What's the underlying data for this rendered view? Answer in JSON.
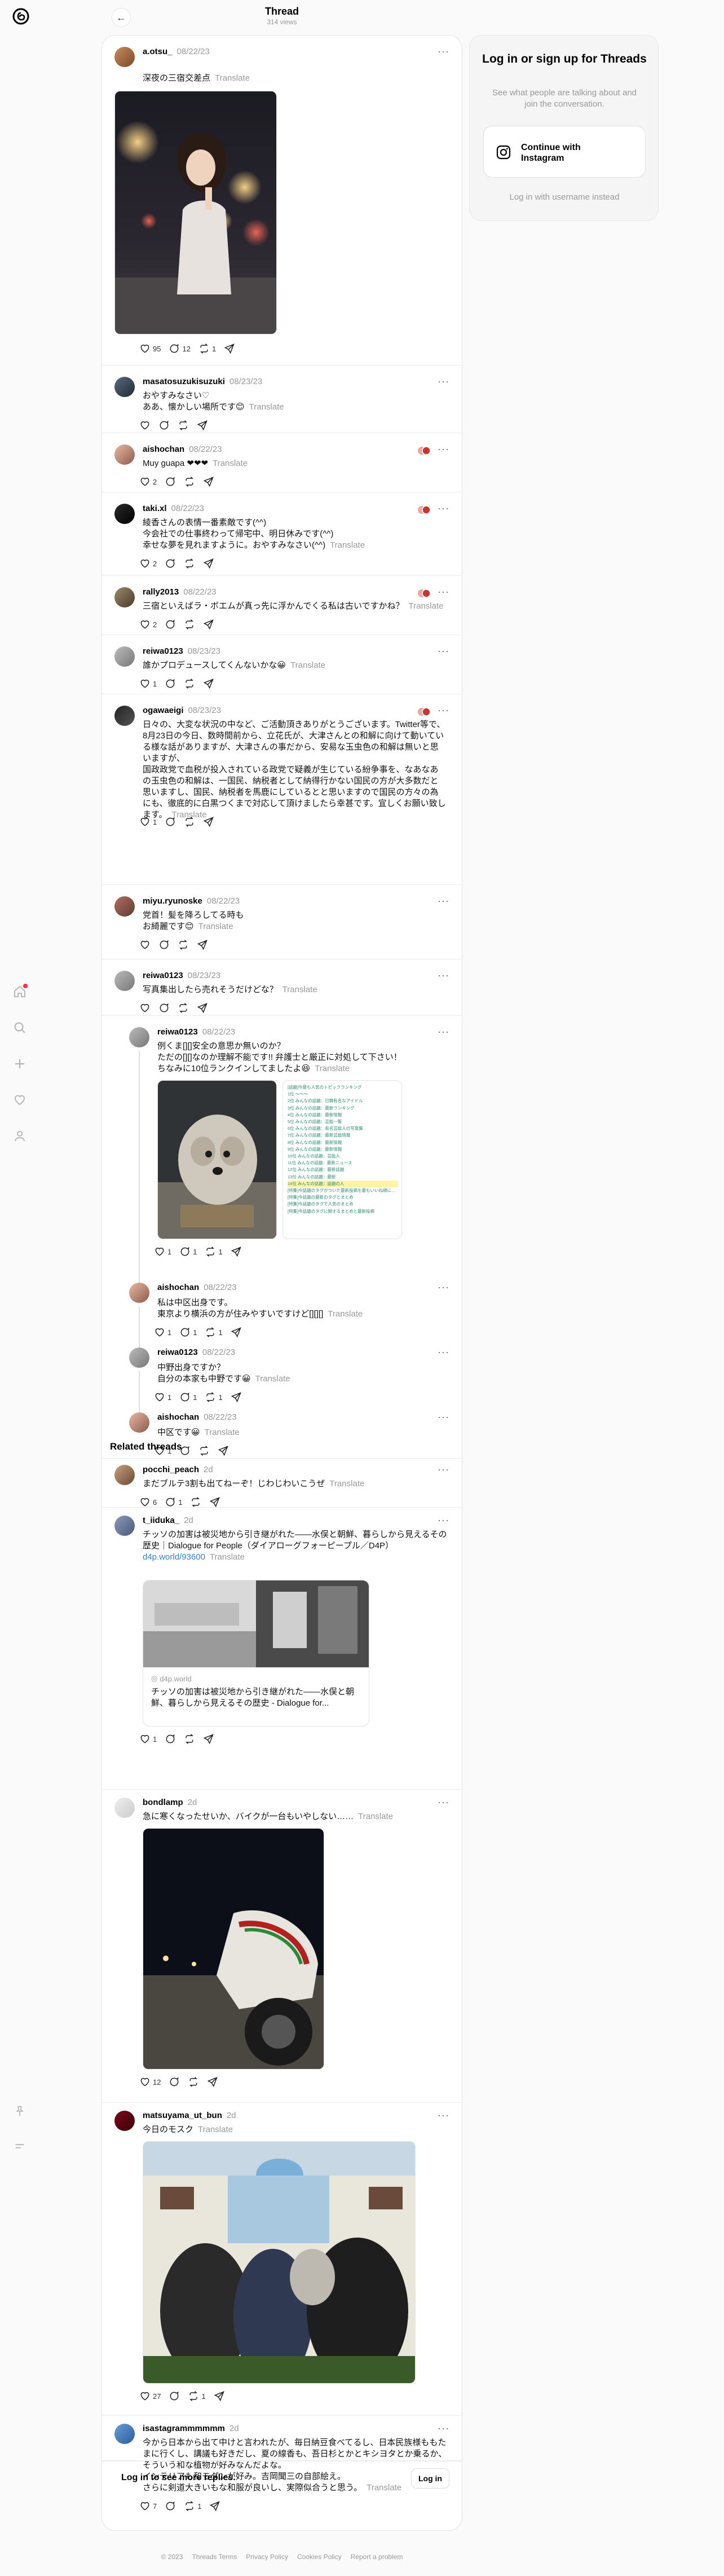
{
  "header": {
    "title": "Thread",
    "views": "314 views"
  },
  "posts": [
    {
      "user": "a.otsu_",
      "date": "08/22/23",
      "lines": [
        "深夜の三宿交差点"
      ],
      "translate": "Translate",
      "likes": "95",
      "replies": "12",
      "reposts": "1"
    },
    {
      "user": "masatosuzukisuzuki",
      "date": "08/23/23",
      "lines": [
        "おやすみなさい♡",
        "ああ、懐かしい場所です😊"
      ],
      "translate": "Translate"
    },
    {
      "user": "aishochan",
      "date": "08/22/23",
      "lines": [
        "Muy guapa ❤❤❤"
      ],
      "translate": "Translate",
      "likes": "2"
    },
    {
      "user": "taki.xl",
      "date": "08/22/23",
      "lines": [
        "綾香さんの表情一番素敵です(^^)",
        "今会社での仕事終わって帰宅中、明日休みです(^^)",
        "幸せな夢を見れますように。おやすみなさい(^^)"
      ],
      "translate": "Translate",
      "likes": "2"
    },
    {
      "user": "rally2013",
      "date": "08/22/23",
      "lines": [
        "三宿といえばラ・ボエムが真っ先に浮かんでくる私は古いですかね？"
      ],
      "translate": "Translate",
      "likes": "2"
    },
    {
      "user": "reiwa0123",
      "date": "08/23/23",
      "lines": [
        "誰かプロデュースしてくんないかな😀"
      ],
      "translate": "Translate",
      "likes": "1"
    },
    {
      "user": "ogawaeigi",
      "date": "08/23/23",
      "lines": [
        "日々の、大変な状況の中など、ご活動頂きありがとうございます。Twitter等で、8月23日の今日、数時間前から、立花氏が、大津さんとの和解に向けて動いている様な話がありますが、大津さんの事だから、安易な玉虫色の和解は無いと思いますが、",
        "国政政党で血税が投入されている政党で疑義が生じている紛争事を、なあなあの玉虫色の和解は、一国民、納税者として納得行かない国民の方が大多数だと思いますし、国民、納税者を馬鹿にしているとと思いますので国民の方々の為にも、徹底的に白黒つくまで対応して頂けましたら幸甚です。宜しくお願い致します。"
      ],
      "translate": "Translate",
      "likes": "1"
    },
    {
      "user": "miyu.ryunoske",
      "date": "08/22/23",
      "lines": [
        "党首！髪を降ろしてる時も",
        "お綺麗です😊"
      ],
      "translate": "Translate"
    },
    {
      "user": "reiwa0123",
      "date": "08/23/23",
      "lines": [
        "写真集出したら売れそうだけどな？"
      ],
      "translate": "Translate"
    },
    {
      "user": "reiwa0123",
      "date": "08/22/23",
      "lines": [
        "例くま[][]安全の意思か無いのか？",
        "ただの[][]なのか理解不能です!! 弁護士と厳正に対処して下さい！",
        "ちなみに10位ランクインしてましたよ😆"
      ],
      "translate": "Translate",
      "likes": "1",
      "replies": "1",
      "reposts": "1",
      "ranking": [
        "[話題]今最も人気のトピックランキング",
        "1位 ～～～",
        "2位 みんなの話題：日韓有名なアイドル",
        "3位 みんなの話題：最新ランキング",
        "4位 みんなの話題：最新情報",
        "5位 みんなの話題：芸能一覧",
        "6位 みんなの話題：有名芸能人の写真集",
        "7位 みんなの話題：最新芸能情報",
        "8位 みんなの話題：最新情報",
        "9位 みんなの話題：最新情報",
        "10位 みんなの話題：芸能人",
        "11位 みんなの話題：最新ニュース",
        "12位 みんなの話題：最新話題",
        "13位 みんなの話題：最新",
        "14位 みんなの話題：話題の人",
        "[特集]今話題のタグがついた最新投稿を最もいいね順に並べています",
        "[特集]今話題の最新のタグとまとめ",
        "[特集]今話題のタグで人気のまとめ",
        "[特集]今話題のタグに関するまとめと最新投稿"
      ]
    },
    {
      "user": "aishochan",
      "date": "08/22/23",
      "lines": [
        "私は中区出身です。",
        "東京より横浜の方が住みやすいですけど[][][]"
      ],
      "translate": "Translate",
      "likes": "1",
      "replies": "1",
      "reposts": "1"
    },
    {
      "user": "reiwa0123",
      "date": "08/22/23",
      "lines": [
        "中野出身ですか？",
        "自分の本家も中野です😀"
      ],
      "translate": "Translate",
      "likes": "1",
      "replies": "1",
      "reposts": "1"
    },
    {
      "user": "aishochan",
      "date": "08/22/23",
      "lines": [
        "中区です😀"
      ],
      "translate": "Translate",
      "likes": "1"
    }
  ],
  "related": {
    "heading": "Related threads",
    "items": [
      {
        "user": "pocchi_peach",
        "date": "2d",
        "lines": [
          "まだブルテ3割も出てねーぞ！じわじわいこうぜ"
        ],
        "translate": "Translate",
        "likes": "6",
        "replies": "1"
      },
      {
        "user": "t_iiduka_",
        "date": "2d",
        "lines": [
          "チッソの加害は被災地から引き継がれた――水俣と朝鮮、暮らしから見えるその歴史｜Dialogue for People（ダイアローグフォーピープル／D4P）"
        ],
        "link": "d4p.world/93600",
        "translate": "Translate",
        "card_domain": "d4p.world",
        "card_title": "チッソの加害は被災地から引き継がれた――水俣と朝鮮、暮らしから見えるその歴史 - Dialogue for...",
        "likes": "1"
      },
      {
        "user": "bondlamp",
        "date": "2d",
        "lines": [
          "急に寒くなったせいか、バイクが一台もいやしない……"
        ],
        "translate": "Translate",
        "likes": "12"
      },
      {
        "user": "matsuyama_ut_bun",
        "date": "2d",
        "lines": [
          "今日のモスク"
        ],
        "translate": "Translate",
        "likes": "27",
        "reposts": "1"
      },
      {
        "user": "isastagrammmmmm",
        "date": "2d",
        "lines": [
          "今から日本から出て中けと言われたが、毎日納豆食べてるし、日本民族様ももたまに行くし、講議も好きだし、夏の線香も、吾日杉とかとキシヨタとか乗るか、そういう和な植物が好みなんだよな。",
          "インテリアも和モダンが好み。吉岡聞三の自部絵え。",
          "さらに剣道大きいもな和服が良いし、実際似合うと思う。"
        ],
        "translate": "Translate",
        "likes": "7",
        "reposts": "1"
      }
    ]
  },
  "login_bar": {
    "text": "Log in to see more replies.",
    "button": "Log in"
  },
  "card": {
    "title": "Log in or sign up for Threads",
    "subtitle": "See what people are talking about and join the conversation.",
    "button": "Continue with Instagram",
    "alt": "Log in with username instead"
  },
  "footer": [
    "© 2023",
    "Threads Terms",
    "Privacy Policy",
    "Cookies Policy",
    "Report a problem"
  ],
  "colors": {
    "link": "#3b7fc4",
    "muted": "#999999",
    "notification": "#ff3040",
    "border": "#e3e3e3"
  }
}
